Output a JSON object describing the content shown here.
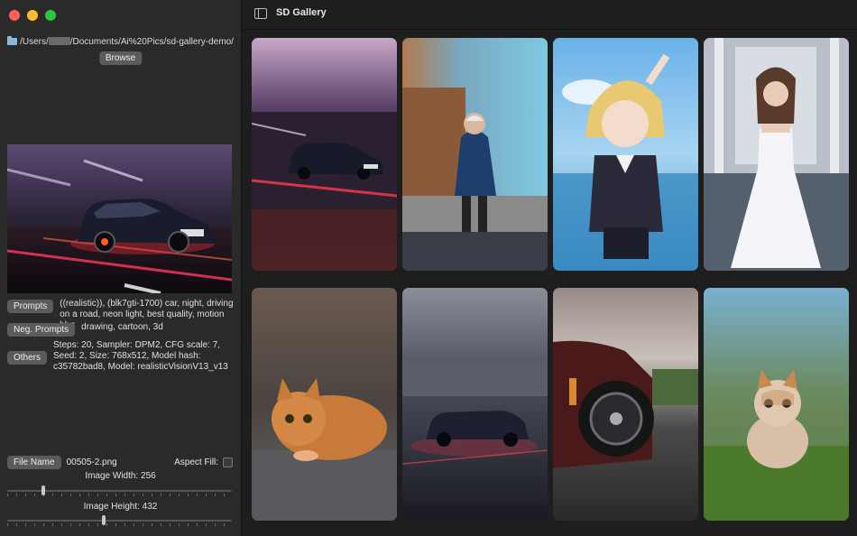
{
  "window": {
    "title": "SD Gallery"
  },
  "sidebar": {
    "path": {
      "prefix": "/Users/",
      "suffix": "/Documents/Ai%20Pics/sd-gallery-demo/"
    },
    "browse_label": "Browse",
    "prompts_label": "Prompts",
    "prompts_text": "((realistic)), (blk7gti-1700) car, night, driving on a road, neon light, best quality, motion blur",
    "neg_label": "Neg. Prompts",
    "neg_text": "drawing, cartoon, 3d",
    "others_label": "Others",
    "others_text": "Steps: 20, Sampler: DPM2, CFG scale: 7, Seed: 2, Size: 768x512, Model hash: c35782bad8, Model: realisticVisionV13_v13",
    "file_name_label": "File Name",
    "file_name_value": "00505-2.png",
    "aspect_fill_label": "Aspect Fill:",
    "aspect_fill_checked": false,
    "width_label": "Image Width: 256",
    "height_label": "Image Height: 432",
    "width_slider_fraction": 0.16,
    "height_slider_fraction": 0.43
  },
  "gallery": {
    "items": [
      {
        "subject": "car-night-neon",
        "accent": "#b3456a"
      },
      {
        "subject": "old-man-jacket",
        "accent": "#2f5b8c"
      },
      {
        "subject": "anime-girl",
        "accent": "#5aa9e6"
      },
      {
        "subject": "woman-white-dress",
        "accent": "#e8e8ee"
      },
      {
        "subject": "orange-kitten",
        "accent": "#d98a3c"
      },
      {
        "subject": "car-dusk",
        "accent": "#6a6f80"
      },
      {
        "subject": "sports-car-wheel",
        "accent": "#5a1e1e"
      },
      {
        "subject": "kitten-grass",
        "accent": "#5a8f3a"
      }
    ]
  }
}
